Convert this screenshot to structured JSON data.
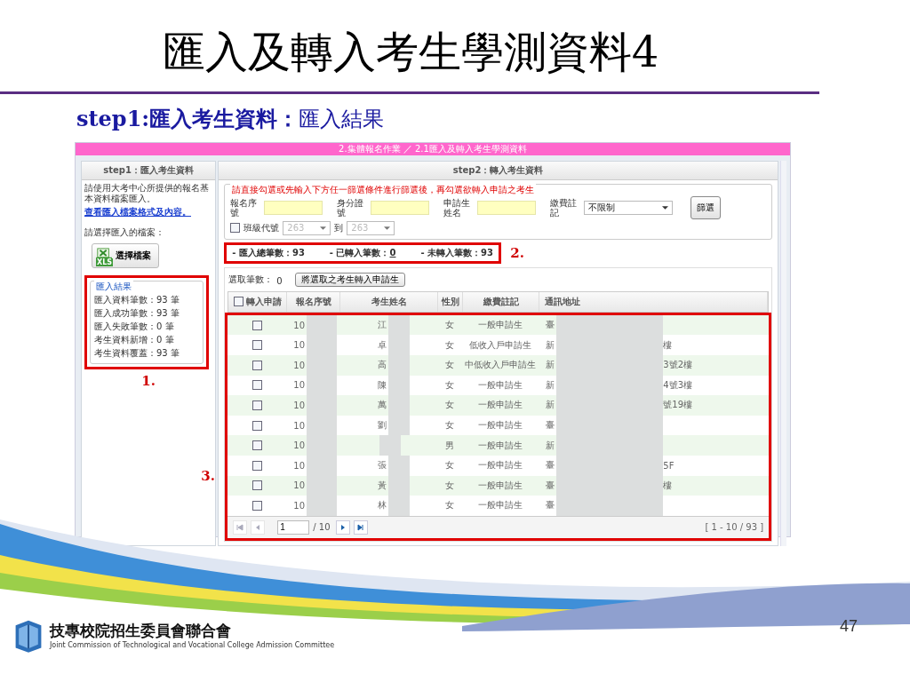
{
  "slide": {
    "title": "匯入及轉入考生學測資料4",
    "heading": "**step1:匯入考生資料：**匯入結果",
    "page_number": "47",
    "footer": {
      "org_name": "技專校院招生委員會聯合會",
      "org_name_en": "Joint Commission of Technological and Vocational College Admission Committee"
    }
  },
  "app": {
    "breadcrumb": "2.集體報名作業 ／ 2.1匯入及轉入考生學測資料",
    "step1_tab": "step1：匯入考生資料",
    "step2_tab": "step2：轉入考生資料",
    "left": {
      "instructions": "請使用大考中心所提供的報名基本資料檔案匯入。",
      "format_link": "查看匯入檔案格式及內容。",
      "choose_label": "請選擇匯入的檔案：",
      "choose_button": "選擇檔案",
      "file_icon_text": "XLS",
      "results": {
        "legend": "匯入結果",
        "lines": [
          "匯入資料筆數：93 筆",
          "匯入成功筆數：93 筆",
          "匯入失敗筆數：0 筆",
          "考生資料新增：0 筆",
          "考生資料覆蓋：93 筆"
        ]
      }
    },
    "annotations": [
      "1.",
      "2.",
      "3."
    ],
    "filter": {
      "legend": "請直接勾選或先輸入下方任一篩選條件進行篩選後，再勾選欲轉入申請之考生",
      "fields": [
        {
          "label": "報名序號"
        },
        {
          "label": "身分證號"
        },
        {
          "label": "申請生姓名"
        }
      ],
      "fee_label": "繳費註記",
      "fee_value": "不限制",
      "filter_button": "篩選",
      "class_checkbox": {
        "label": "班級代號",
        "checked": false
      },
      "class_from": "263",
      "to_label": "到",
      "class_to": "263"
    },
    "counts": [
      {
        "label": "- 匯入總筆數：",
        "value": "93",
        "link": false
      },
      {
        "label": "- 已轉入筆數：",
        "value": "0",
        "link": true
      },
      {
        "label": "- 未轉入筆數：",
        "value": "93",
        "link": false
      }
    ],
    "selected_count_label": "選取筆數：",
    "selected_count": "0",
    "transfer_button": "將選取之考生轉入申請生",
    "table": {
      "header_checkbox": {
        "checked": false
      },
      "columns": [
        "轉入申請",
        "報名序號",
        "考生姓名",
        "性別",
        "繳費註記",
        "通訊地址"
      ],
      "rows": [
        {
          "checked": false,
          "serial": "10",
          "name": "江",
          "gender": "女",
          "fee": "一般申請生",
          "address_start": "臺"
        },
        {
          "checked": false,
          "serial": "10",
          "name": "卓",
          "gender": "女",
          "fee": "低收入戶申請生",
          "address_start": "新",
          "address_end": "樓"
        },
        {
          "checked": false,
          "serial": "10",
          "name": "高",
          "gender": "女",
          "fee": "中低收入戶申請生",
          "address_start": "新",
          "address_end": "3號2樓"
        },
        {
          "checked": false,
          "serial": "10",
          "name": "陳",
          "gender": "女",
          "fee": "一般申請生",
          "address_start": "新",
          "address_end": "4號3樓"
        },
        {
          "checked": false,
          "serial": "10",
          "name": "萬",
          "gender": "女",
          "fee": "一般申請生",
          "address_start": "新",
          "address_end": "號19樓"
        },
        {
          "checked": false,
          "serial": "10",
          "name": "劉",
          "gender": "女",
          "fee": "一般申請生",
          "address_start": "臺"
        },
        {
          "checked": false,
          "serial": "10",
          "gender": "男",
          "fee": "一般申請生",
          "address_start": "新"
        },
        {
          "checked": false,
          "serial": "10",
          "name": "張",
          "gender": "女",
          "fee": "一般申請生",
          "address_start": "臺",
          "address_end": "5F"
        },
        {
          "checked": false,
          "serial": "10",
          "name": "黃",
          "gender": "女",
          "fee": "一般申請生",
          "address_start": "臺",
          "address_end": "樓"
        },
        {
          "checked": false,
          "serial": "10",
          "name": "林",
          "gender": "女",
          "fee": "一般申請生",
          "address_start": "臺"
        }
      ]
    },
    "pager": {
      "page": "1",
      "total": "/ 10",
      "range": "[ 1 - 10 / 93 ]"
    }
  }
}
